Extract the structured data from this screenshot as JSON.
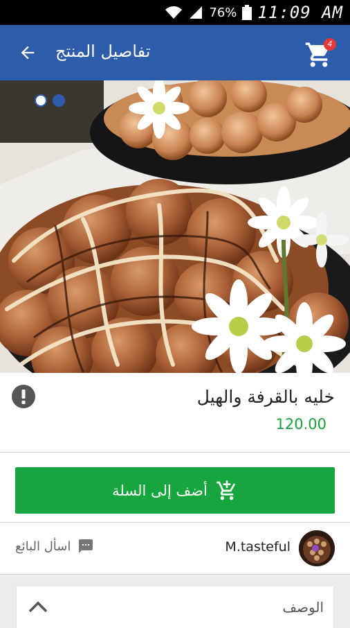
{
  "status_bar": {
    "battery": "76%",
    "time": "11:09 AM"
  },
  "app_bar": {
    "title": "تفاصيل المنتج",
    "cart_count": "4"
  },
  "carousel": {
    "total_images": 2,
    "active_index": 1
  },
  "product": {
    "name": "خليه بالقرفة والهيل",
    "price": "120.00"
  },
  "actions": {
    "add_to_cart": "أضف إلى السلة"
  },
  "seller": {
    "name": "M.tasteful",
    "ask_label": "اسأل البائع"
  },
  "description": {
    "label": "الوصف"
  },
  "colors": {
    "app_bar": "#2d5cab",
    "primary_green": "#17a53e",
    "price_green": "#1a9e3c",
    "badge_red": "#e53935"
  }
}
